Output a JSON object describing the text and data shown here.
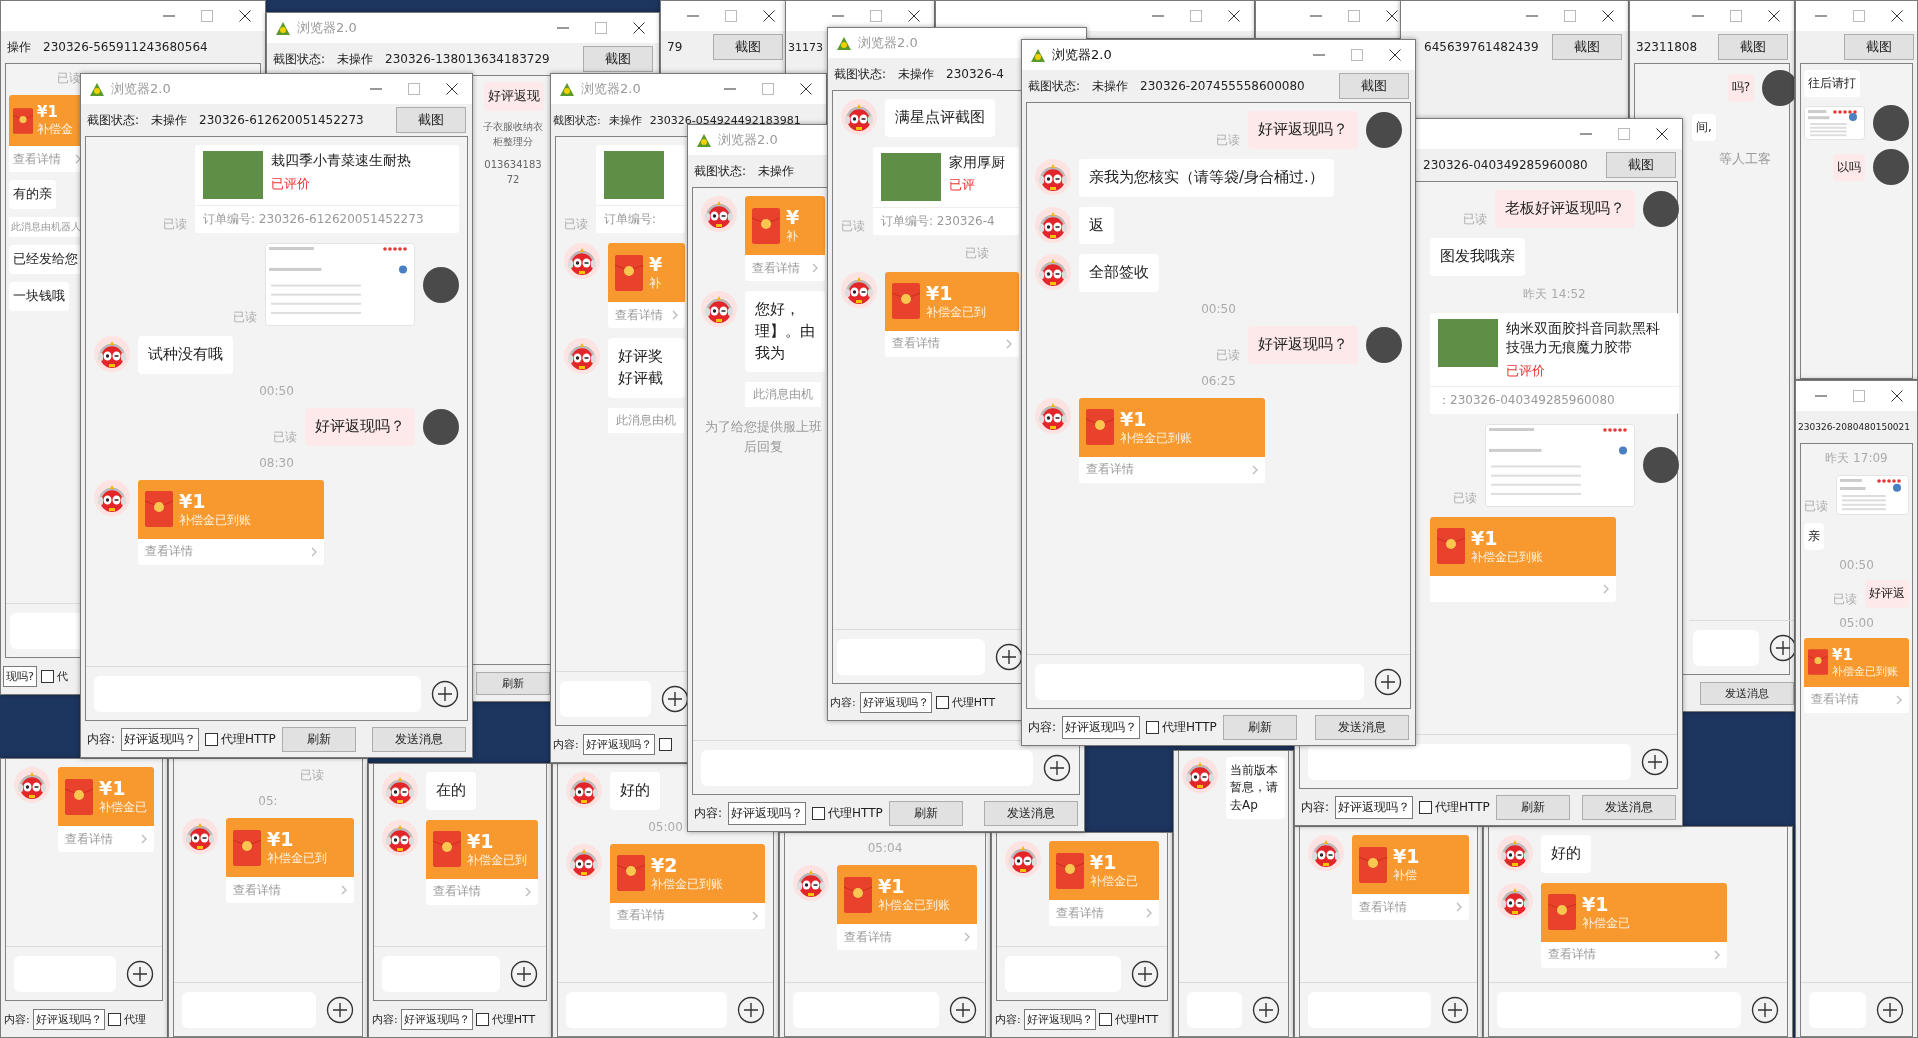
{
  "windows": [
    {
      "kind": "window",
      "status": {
        "state": "操作",
        "id": "230326-565911243680564"
      },
      "messages": [
        {
          "kind": "read",
          "text": "已读"
        },
        {
          "kind": "redpacket",
          "amount": "¥1",
          "label": "补偿金",
          "details": "查看详情"
        },
        {
          "kind": "in",
          "text": "有的亲"
        },
        {
          "kind": "notice",
          "text": "此消息由机器人"
        },
        {
          "kind": "in",
          "text": "已经发给您"
        },
        {
          "kind": "in",
          "text": "一块钱哦"
        }
      ],
      "compose": true,
      "footer": {
        "value": "现吗?",
        "checkbox": {
          "label": "代",
          "checked": false
        }
      }
    },
    {
      "kind": "window",
      "title": "浏览器2.0",
      "active": false,
      "status": {
        "label": "截图状态:",
        "state": "未操作",
        "id": "230326-138013634183729",
        "button": "截图"
      },
      "messages": [
        {
          "kind": "out",
          "text": "好评返现"
        },
        {
          "kind": "system",
          "text": "子衣服收纳衣柜整理分"
        },
        {
          "kind": "system",
          "text": "01363418372"
        }
      ],
      "footer": {
        "refresh": "刷新"
      }
    },
    {
      "kind": "window",
      "status": {
        "id": "79",
        "button": "截图"
      }
    },
    {
      "kind": "window",
      "status": {
        "id": "31173"
      }
    },
    {
      "kind": "window"
    },
    {
      "kind": "window"
    },
    {
      "kind": "window",
      "status": {
        "id": "645639761482439",
        "button": "截图"
      }
    },
    {
      "kind": "window",
      "status": {
        "id": "32311808",
        "button": "截图"
      },
      "messages": [
        {
          "kind": "out",
          "text": "吗?"
        },
        {
          "kind": "in",
          "text": "间,"
        },
        {
          "kind": "system",
          "text": "等人工客"
        }
      ],
      "compose": true,
      "footer": {
        "send": "发送消息"
      }
    },
    {
      "kind": "window",
      "status": {
        "button": "截图"
      },
      "messages": [
        {
          "kind": "in",
          "text": "往后请打"
        },
        {
          "kind": "shot"
        },
        {
          "kind": "out",
          "text": "以吗"
        }
      ]
    },
    {
      "kind": "window",
      "status": {
        "id": "230326-2080480150021"
      },
      "messages": [
        {
          "kind": "time",
          "text": "昨天 17:09"
        },
        {
          "kind": "shot",
          "read": "已读"
        },
        {
          "kind": "in",
          "text": "亲"
        },
        {
          "kind": "time",
          "text": "00:50"
        },
        {
          "kind": "out",
          "text": "好评返",
          "read": "已读"
        },
        {
          "kind": "time",
          "text": "05:00"
        },
        {
          "kind": "redpacket",
          "amount": "¥1",
          "label": "补偿金已到账",
          "details": "查看详情"
        }
      ],
      "compose": true
    },
    {
      "kind": "fragment",
      "messages": [
        {
          "kind": "redpacket",
          "amount": "¥1",
          "label": "补偿金已",
          "details": "查看详情"
        }
      ],
      "compose": true,
      "footer": {
        "label": "内容:",
        "value": "好评返现吗？",
        "checkbox": {
          "label": "代理",
          "checked": false
        }
      }
    },
    {
      "kind": "fragment",
      "messages": [
        {
          "kind": "read",
          "text": "已读"
        },
        {
          "kind": "time",
          "text": "05:"
        },
        {
          "kind": "redpacket",
          "amount": "¥1",
          "label": "补偿金已到",
          "details": "查看详情"
        }
      ],
      "compose": true
    },
    {
      "kind": "fragment",
      "messages": [
        {
          "kind": "in",
          "text": "在的"
        },
        {
          "kind": "redpacket",
          "amount": "¥1",
          "label": "补偿金已到",
          "details": "查看详情"
        }
      ],
      "compose": true,
      "footer": {
        "label": "内容:",
        "value": "好评返现吗？",
        "checkbox": {
          "label": "代理HTT",
          "checked": false
        }
      }
    },
    {
      "kind": "fragment",
      "messages": [
        {
          "kind": "in",
          "text": "好的"
        },
        {
          "kind": "time",
          "text": "05:00"
        },
        {
          "kind": "redpacket",
          "amount": "¥2",
          "label": "补偿金已到账",
          "details": "查看详情"
        }
      ],
      "compose": true
    },
    {
      "kind": "fragment",
      "messages": [
        {
          "kind": "time",
          "text": "05:04"
        },
        {
          "kind": "redpacket",
          "amount": "¥1",
          "label": "补偿金已到账",
          "details": "查看详情"
        }
      ],
      "compose": true
    },
    {
      "kind": "fragment",
      "messages": [
        {
          "kind": "redpacket",
          "amount": "¥1",
          "label": "补偿金已",
          "details": "查看详情"
        }
      ],
      "compose": true,
      "footer": {
        "label": "内容:",
        "value": "好评返现吗？",
        "checkbox": {
          "label": "代理HTT",
          "checked": false
        }
      }
    },
    {
      "kind": "fragment",
      "messages": [
        {
          "kind": "in",
          "text": "当前版本暂息，请去Ap"
        }
      ],
      "compose": true
    },
    {
      "kind": "fragment",
      "messages": [
        {
          "kind": "redpacket",
          "amount": "¥1",
          "label": "补偿",
          "details": "查看详情"
        }
      ],
      "compose": true
    },
    {
      "kind": "fragment",
      "messages": [
        {
          "kind": "in",
          "text": "好的"
        },
        {
          "kind": "redpacket",
          "amount": "¥1",
          "label": "补偿金已",
          "details": "查看详情"
        }
      ],
      "compose": true
    },
    {
      "kind": "window",
      "title": "浏览器2.0",
      "active": false,
      "status": {
        "label": "截图状态:",
        "state": "未操作",
        "id": "230326-054924492183981"
      },
      "messages": [
        {
          "kind": "order",
          "order_no": "订单编号:",
          "read": "已读"
        },
        {
          "kind": "redpacket",
          "amount": "¥",
          "label": "补",
          "details": "查看详情"
        },
        {
          "kind": "in",
          "text": "好评奖好评截"
        },
        {
          "kind": "notice",
          "text": "此消息由机"
        }
      ],
      "compose": true,
      "footer": {
        "label": "内容:",
        "value": "好评返现吗？",
        "checkbox": {
          "checked": false
        }
      }
    },
    {
      "kind": "window",
      "title": "浏览器2.0",
      "active": false,
      "status": {
        "label": "截图状态:",
        "state": "未操作"
      },
      "messages": [
        {
          "kind": "redpacket",
          "amount": "¥",
          "label": "补",
          "details": "查看详情"
        },
        {
          "kind": "in",
          "text": "您好，理】。由我为"
        },
        {
          "kind": "notice",
          "text": "此消息由机"
        },
        {
          "kind": "system",
          "text": "为了给您提供服上班后回复"
        }
      ],
      "compose": true,
      "footer": {
        "label": "内容:",
        "value": "好评返现吗？",
        "checkbox": {
          "label": "代理HTTP",
          "checked": false
        },
        "refresh": "刷新",
        "send": "发送消息"
      }
    },
    {
      "kind": "window",
      "title": "浏览器2.0",
      "active": false,
      "status": {
        "label": "截图状态:",
        "state": "未操作",
        "id": "230326-4"
      },
      "messages": [
        {
          "kind": "in",
          "text": "满星点评截图"
        },
        {
          "kind": "order",
          "title": "家用厚厨",
          "status": "已评",
          "order_no": "订单编号: 230326-4",
          "read": "已读"
        },
        {
          "kind": "read",
          "text": "已读"
        },
        {
          "kind": "redpacket",
          "amount": "¥1",
          "label": "补偿金已到",
          "details": "查看详情"
        }
      ],
      "compose": true,
      "footer": {
        "label": "内容:",
        "value": "好评返现吗？",
        "checkbox": {
          "label": "代理HTT",
          "checked": false
        }
      }
    },
    {
      "kind": "window",
      "title": "浏览器2.0",
      "active": false,
      "status": {
        "label": "截图状态:",
        "state": "未操作",
        "id": "230326-612620051452273",
        "button": "截图"
      },
      "messages": [
        {
          "kind": "order",
          "title": "栽四季小青菜速生耐热",
          "status": "已评价",
          "order_no": "订单编号: 230326-612620051452273",
          "read": "已读"
        },
        {
          "kind": "shot",
          "read": "已读"
        },
        {
          "kind": "in",
          "text": "试种没有哦"
        },
        {
          "kind": "time",
          "text": "00:50"
        },
        {
          "kind": "out",
          "text": "好评返现吗？",
          "read": "已读"
        },
        {
          "kind": "time",
          "text": "08:30"
        },
        {
          "kind": "redpacket",
          "amount": "¥1",
          "label": "补偿金已到账",
          "details": "查看详情"
        }
      ],
      "compose": true,
      "footer": {
        "label": "内容:",
        "value": "好评返现吗？",
        "checkbox": {
          "label": "代理HTTP",
          "checked": false
        },
        "refresh": "刷新",
        "send": "发送消息"
      }
    },
    {
      "kind": "window",
      "status": {
        "id": "230326-040349285960080",
        "button": "截图"
      },
      "messages": [
        {
          "kind": "out",
          "text": "老板好评返现吗？",
          "read": "已读"
        },
        {
          "kind": "in",
          "text": "图发我哦亲"
        },
        {
          "kind": "time",
          "text": "昨天 14:52"
        },
        {
          "kind": "order",
          "title": "纳米双面胶抖音同款黑科技强力无痕魔力胶带",
          "status": "已评价",
          "order_no": "：230326-040349285960080"
        },
        {
          "kind": "shot",
          "read": "已读"
        },
        {
          "kind": "redpacket",
          "amount": "¥1",
          "label": "补偿金已到账"
        }
      ],
      "compose": true,
      "footer": {
        "label": "内容:",
        "value": "好评返现吗？",
        "checkbox": {
          "label": "代理HTTP",
          "checked": false
        },
        "refresh": "刷新",
        "send": "发送消息"
      }
    },
    {
      "kind": "window",
      "title": "浏览器2.0",
      "active": true,
      "status": {
        "label": "截图状态:",
        "state": "未操作",
        "id": "230326-207455558600080",
        "button": "截图"
      },
      "messages": [
        {
          "kind": "out",
          "text": "好评返现吗？",
          "read": "已读"
        },
        {
          "kind": "in",
          "text": "亲我为您核实（请等袋/身合桶过.）"
        },
        {
          "kind": "in",
          "text": "返"
        },
        {
          "kind": "in",
          "text": "全部签收"
        },
        {
          "kind": "time",
          "text": "00:50"
        },
        {
          "kind": "out",
          "text": "好评返现吗？",
          "read": "已读"
        },
        {
          "kind": "time",
          "text": "06:25"
        },
        {
          "kind": "redpacket",
          "amount": "¥1",
          "label": "补偿金已到账",
          "details": "查看详情"
        }
      ],
      "compose": true,
      "footer": {
        "label": "内容:",
        "value": "好评返现吗？",
        "checkbox": {
          "label": "代理HTTP",
          "checked": false
        },
        "refresh": "刷新",
        "send": "发送消息"
      }
    }
  ]
}
